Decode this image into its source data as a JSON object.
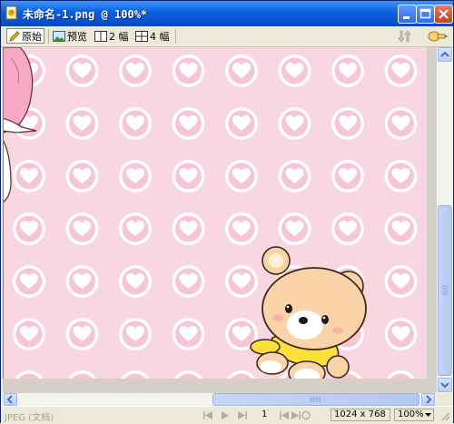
{
  "window": {
    "title": "未命名-1.png @ 100%*",
    "controls": [
      "minimize",
      "maximize",
      "close"
    ]
  },
  "toolbar": {
    "tabs": [
      {
        "label": "原始",
        "icon": "pencil-icon",
        "active": true
      },
      {
        "label": "预览",
        "icon": "image-icon",
        "active": false
      },
      {
        "label": "2 幅",
        "icon": "two-up-icon",
        "active": false
      },
      {
        "label": "4 幅",
        "icon": "four-up-icon",
        "active": false
      }
    ]
  },
  "canvas": {
    "pattern": "pink heart circles",
    "background_color": "#F9D7E0",
    "circle_color": "#FFFFFF",
    "heart_color": "#F6C6D3"
  },
  "status": {
    "format": "JPEG (文档)",
    "page": "1",
    "dimensions": "1024 x 768",
    "zoom": "100%"
  }
}
